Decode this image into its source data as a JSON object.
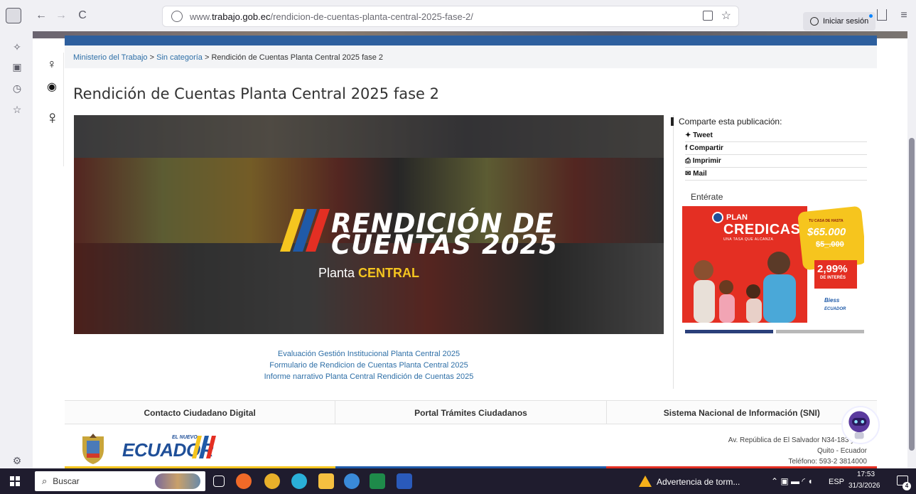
{
  "browser": {
    "url_prefix": "www.",
    "url_domain": "trabajo.gob.ec",
    "url_path": "/rendicion-de-cuentas-planta-central-2025-fase-2/",
    "signin_label": "Iniciar sesión",
    "back_icon": "←",
    "forward_icon": "→",
    "reload_icon": "C",
    "star_icon": "☆",
    "menu_icon": "≡"
  },
  "breadcrumb": {
    "home": "Ministerio del Trabajo",
    "sep1": " > ",
    "category": "Sin categoría",
    "sep2": " > ",
    "current": "Rendición de Cuentas Planta Central 2025 fase 2"
  },
  "page": {
    "title": "Rendición de Cuentas Planta Central 2025 fase 2",
    "hero_line1": "RENDICIÓN DE",
    "hero_line2": "CUENTAS 2025",
    "hero_sub_a": "Planta ",
    "hero_sub_b": "CENTRAL",
    "links": [
      "Evaluación Gestión Institucional Planta Central 2025",
      "Formulario de Rendicion de Cuentas Planta Central 2025",
      "Informe narrativo Planta Central Rendición de Cuentas 2025"
    ]
  },
  "sidebar": {
    "share_heading": "Comparte esta publicación:",
    "share_items": [
      "Tweet",
      "Compartir",
      "Imprimir",
      "Mail"
    ],
    "entrate": "Entérate",
    "ad": {
      "plan": "PLAN",
      "brand": "CREDICASA",
      "tagline": "UNA TASA QUE ALCANZA",
      "price_label": "TU CASA DE HASTA",
      "price": "$65.000",
      "price_old": "$5_.000",
      "rate": "2,99%",
      "rate_label": "DE INTERÉS",
      "biess": "Biess",
      "ecuador": "ECUADOR"
    }
  },
  "services": [
    "Contacto Ciudadano Digital",
    "Portal Trámites Ciudadanos",
    "Sistema Nacional de Información (SNI)"
  ],
  "footer": {
    "logo_small": "EL NUEVO",
    "logo": "ECUADOR",
    "address": "Av. República de El Salvador N34-183 y S...",
    "city": "Quito - Ecuador",
    "phone": "Teléfono: 593-2 3814000"
  },
  "taskbar": {
    "search_placeholder": "Buscar",
    "weather": "Advertencia de torm...",
    "lang": "ESP",
    "time": "17:53",
    "date": "31/3/2026",
    "notif_count": "4"
  },
  "colors": {
    "link": "#2e6fa7",
    "ad_red": "#e42f23",
    "ecuador_blue": "#1f4f98",
    "yellow": "#f5c51f"
  }
}
